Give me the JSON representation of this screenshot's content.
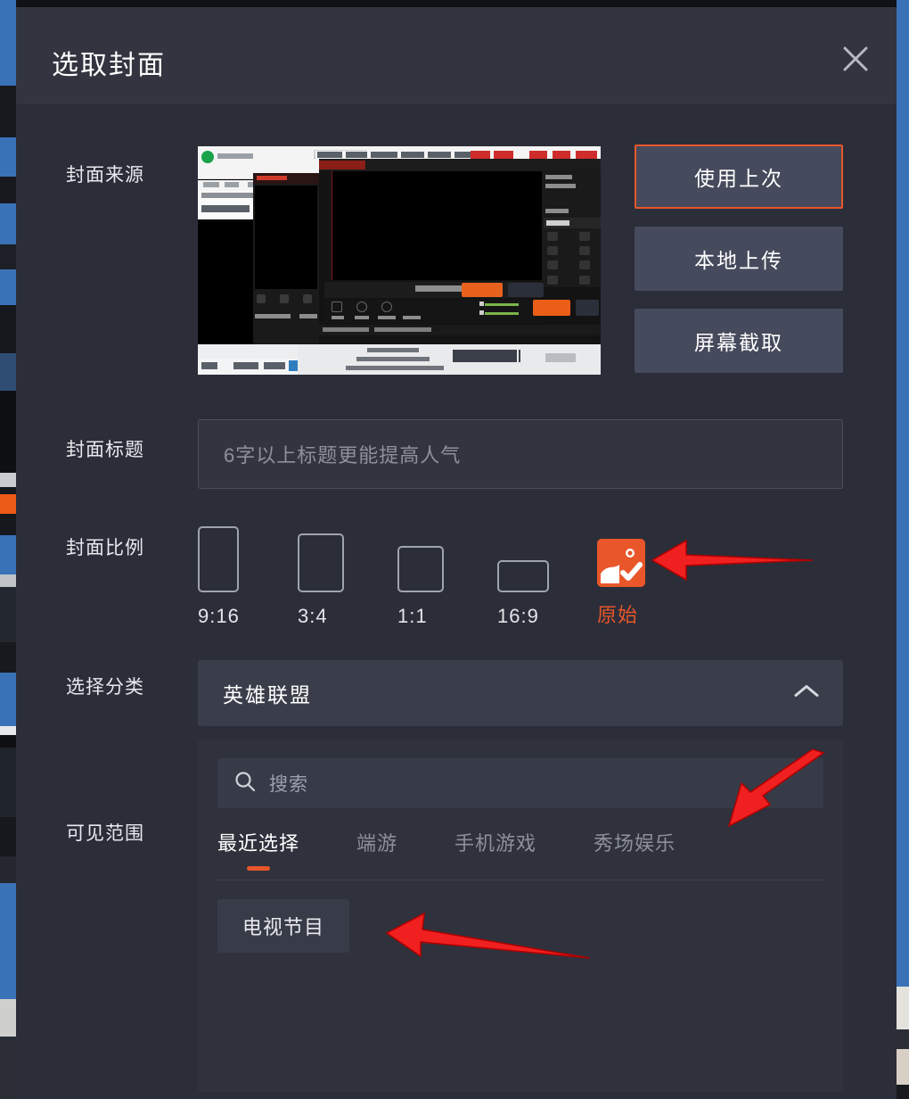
{
  "dialog": {
    "title": "选取封面",
    "close_icon": "close-icon"
  },
  "rows": {
    "cover_source_label": "封面来源",
    "cover_title_label": "封面标题",
    "cover_ratio_label": "封面比例",
    "category_label": "选择分类",
    "scope_label": "可见范围"
  },
  "source": {
    "buttons": [
      {
        "label": "使用上次",
        "selected": true
      },
      {
        "label": "本地上传",
        "selected": false
      },
      {
        "label": "屏幕截取",
        "selected": false
      }
    ]
  },
  "cover_title": {
    "value": "",
    "placeholder": "6字以上标题更能提高人气"
  },
  "ratio": {
    "options": [
      {
        "label": "9:16",
        "selected": false
      },
      {
        "label": "3:4",
        "selected": false
      },
      {
        "label": "1:1",
        "selected": false
      },
      {
        "label": "16:9",
        "selected": false
      },
      {
        "label": "原始",
        "selected": true,
        "icon": "image-check-icon"
      }
    ]
  },
  "category": {
    "selected": "英雄联盟",
    "chevron_icon": "chevron-up-icon"
  },
  "scope": {
    "search": {
      "value": "",
      "placeholder": "搜索",
      "icon": "search-icon"
    },
    "tabs": [
      {
        "label": "最近选择",
        "active": true
      },
      {
        "label": "端游",
        "active": false
      },
      {
        "label": "手机游戏",
        "active": false
      },
      {
        "label": "秀场娱乐",
        "active": false
      }
    ],
    "chips": [
      {
        "label": "电视节目"
      }
    ]
  },
  "colors": {
    "accent": "#e8562a",
    "dialog_bg": "#2b2e39",
    "titlebar_bg": "#32353f",
    "button_bg": "#454a5c",
    "panel_bg": "#2f323d",
    "text_primary": "#ffffff",
    "text_muted": "#8d909c",
    "annotation": "#f02020"
  },
  "annotations": [
    {
      "name": "arrow-to-original-ratio",
      "direction": "left"
    },
    {
      "name": "arrow-to-scope-panel",
      "direction": "down-left"
    },
    {
      "name": "arrow-to-tv-chip",
      "direction": "left"
    }
  ]
}
